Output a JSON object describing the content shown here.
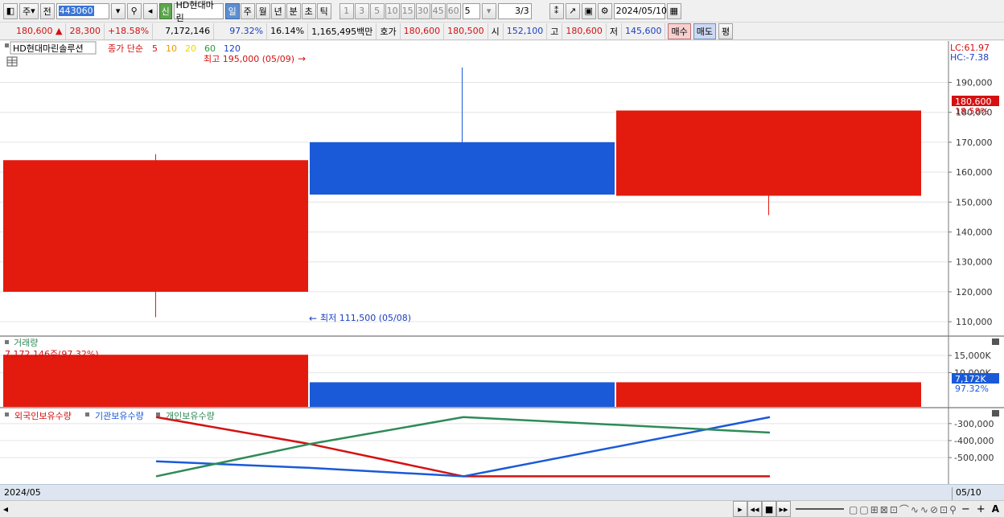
{
  "toolbar": {
    "market": "주",
    "prev_label": "전",
    "code": "443060",
    "new_badge": "신",
    "stock_name": "HD현대마린",
    "periods": [
      "일",
      "주",
      "월",
      "년",
      "분",
      "초",
      "틱"
    ],
    "active_period": "일",
    "intervals": [
      "1",
      "3",
      "5",
      "10",
      "15",
      "30",
      "45",
      "60"
    ],
    "count": "5",
    "page": "3/3",
    "date": "2024/05/10"
  },
  "quote": {
    "price": "180,600",
    "change": "28,300",
    "change_pct": "+18.58%",
    "volume": "7,172,146",
    "vol_ratio": "97.32%",
    "turnover": "16.14%",
    "amount": "1,165,495백만",
    "bid_label": "호가",
    "bid": "180,600",
    "ask": "180,500",
    "open_label": "시",
    "open": "152,100",
    "high_label": "고",
    "high": "180,600",
    "low_label": "저",
    "low": "145,600",
    "buy_label": "매수",
    "sell_label": "매도",
    "eval_label": "평"
  },
  "price_panel": {
    "title": "HD현대마린솔루션",
    "ma_label": "종가 단순",
    "ma_periods": [
      {
        "label": "5",
        "color": "#d41111"
      },
      {
        "label": "10",
        "color": "#e89a00"
      },
      {
        "label": "20",
        "color": "#e8d800"
      },
      {
        "label": "60",
        "color": "#2a9a3a"
      },
      {
        "label": "120",
        "color": "#1a3fc0"
      }
    ],
    "lc": "LC:61.97",
    "hc": "HC:-7.38",
    "high_note": "최고 195,000 (05/09)",
    "low_note": "최저 111,500 (05/08)",
    "last_price_tag": "180,600",
    "last_pct_tag": "18.58%",
    "y_ticks": [
      "190,000",
      "180,000",
      "170,000",
      "160,000",
      "150,000",
      "140,000",
      "130,000",
      "120,000",
      "110,000"
    ]
  },
  "volume_panel": {
    "title": "거래량",
    "note": "7,172,146주(97.32%)",
    "y_ticks": [
      "15,000K",
      "10,000K"
    ],
    "last_tag": "7,172K",
    "last_pct": "97.32%"
  },
  "holding_panel": {
    "legend": [
      {
        "label": "외국인보유수량",
        "color": "#d41111"
      },
      {
        "label": "기관보유수량",
        "color": "#1a5ad8"
      },
      {
        "label": "개인보유수량",
        "color": "#2e8b57"
      }
    ],
    "y_ticks": [
      "-300,000",
      "-400,000",
      "-500,000"
    ]
  },
  "status": {
    "left_date": "2024/05",
    "right_date": "05/10"
  },
  "chart_data": {
    "type": "candlestick",
    "candles": [
      {
        "date": "05/08",
        "open": 120000,
        "close": 164000,
        "high": 166000,
        "low": 111500,
        "color": "#e31a0e"
      },
      {
        "date": "05/09",
        "open": 170000,
        "close": 152500,
        "high": 195000,
        "low": 152500,
        "color": "#1a5ad8"
      },
      {
        "date": "05/10",
        "open": 152100,
        "close": 180600,
        "high": 180600,
        "low": 145600,
        "color": "#e31a0e"
      }
    ],
    "price_range": [
      106000,
      199000
    ],
    "volume": [
      15200,
      7172,
      7172
    ],
    "volume_range": [
      0,
      19000
    ],
    "holdings": [
      {
        "name": "외국인보유수량",
        "color": "#d41111",
        "values": [
          -262000,
          -420000,
          -610000,
          -610000
        ]
      },
      {
        "name": "기관보유수량",
        "color": "#1a5ad8",
        "values": [
          -522000,
          -560000,
          -610000,
          -262000
        ]
      },
      {
        "name": "개인보유수량",
        "color": "#2e8b57",
        "values": [
          -610000,
          -420000,
          -262000,
          -353000
        ]
      }
    ],
    "holding_range": [
      -660000,
      -230000
    ]
  }
}
